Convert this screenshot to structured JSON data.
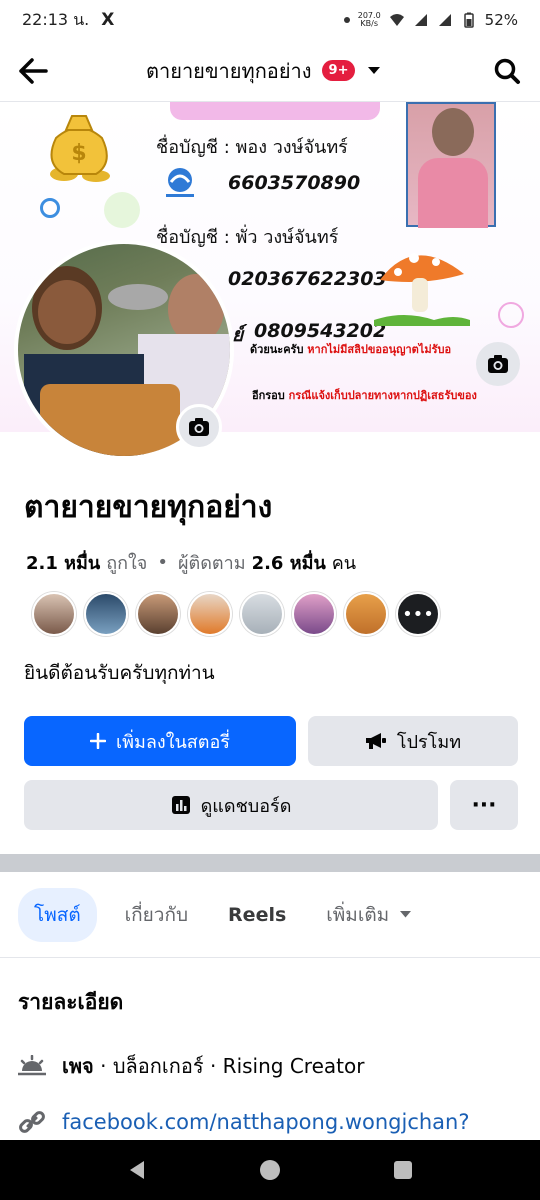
{
  "status_bar": {
    "time": "22:13 น.",
    "x_app": "X",
    "net_speed": "207.0",
    "net_unit": "KB/s",
    "battery": "52%"
  },
  "header": {
    "title": "ตายายขายทุกอย่าง",
    "badge": "9+"
  },
  "cover": {
    "account1_label": "ชื่อบัญชี : พอง  วงษ์จันทร์",
    "account1_number": "6603570890",
    "account2_label": "ชื่อบัญชี : พั่ว   วงษ์จันทร์",
    "account2_number": "020367622303",
    "phone_prefix": "ย์",
    "phone": "0809543202",
    "note_line1_a": "ด้วยนะครับ",
    "note_line1_b": "หากไม่มีสลิปขออนุญาตไม่รับอ",
    "note_line2_a": "อีกรอบ",
    "note_line2_b": "กรณีแจ้งเก็บปลายทางหากปฏิเสธรับของ"
  },
  "profile": {
    "name": "ตายายขายทุกอย่าง",
    "likes_count": "2.1 หมื่น",
    "likes_label": "ถูกใจ",
    "separator": "•",
    "followers_label": "ผู้ติดตาม",
    "followers_count": "2.6 หมื่น",
    "followers_unit": "คน",
    "bio": "ยินดีต้อนรับครับทุกท่าน"
  },
  "actions": {
    "add_story": "เพิ่มลงในสตอรี่",
    "promote": "โปรโมท",
    "dashboard": "ดูแดชบอร์ด",
    "more": "···"
  },
  "tabs": [
    {
      "label": "โพสต์"
    },
    {
      "label": "เกี่ยวกับ"
    },
    {
      "label": "Reels"
    },
    {
      "label": "เพิ่มเติม"
    }
  ],
  "details": {
    "title": "รายละเอียด",
    "category_bold": "เพจ",
    "category_rest": " · บล็อกเกอร์ · Rising Creator",
    "link": "facebook.com/natthapong.wongjchan?"
  },
  "colors": {
    "primary": "#0866ff",
    "badge": "#e41e3f",
    "button_bg": "#e4e6eb"
  }
}
